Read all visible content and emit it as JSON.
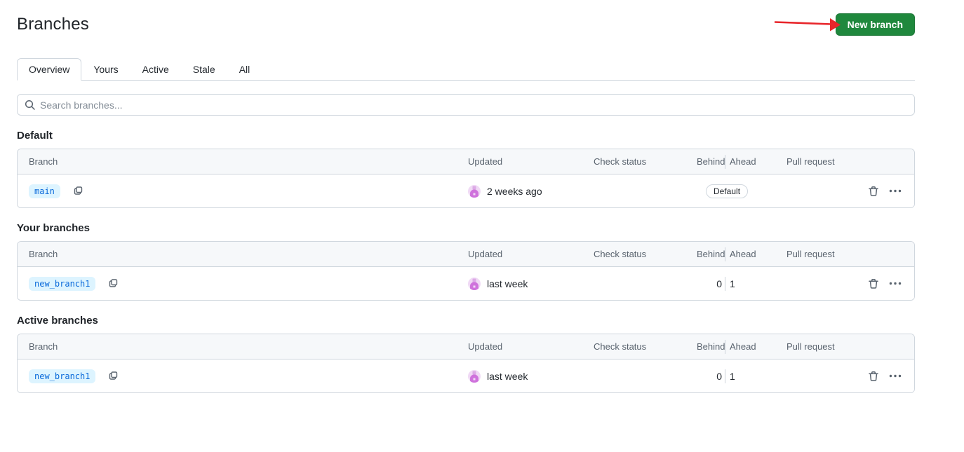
{
  "page": {
    "title": "Branches"
  },
  "header": {
    "new_branch_button": "New branch"
  },
  "tabs": [
    {
      "label": "Overview",
      "selected": true
    },
    {
      "label": "Yours",
      "selected": false
    },
    {
      "label": "Active",
      "selected": false
    },
    {
      "label": "Stale",
      "selected": false
    },
    {
      "label": "All",
      "selected": false
    }
  ],
  "search": {
    "placeholder": "Search branches..."
  },
  "table_headers": {
    "branch": "Branch",
    "updated": "Updated",
    "check_status": "Check status",
    "behind": "Behind",
    "ahead": "Ahead",
    "pull_request": "Pull request"
  },
  "sections": [
    {
      "heading": "Default",
      "rows": [
        {
          "branch": "main",
          "updated": "2 weeks ago",
          "badge": "Default"
        }
      ]
    },
    {
      "heading": "Your branches",
      "rows": [
        {
          "branch": "new_branch1",
          "updated": "last week",
          "behind": "0",
          "ahead": "1"
        }
      ]
    },
    {
      "heading": "Active branches",
      "rows": [
        {
          "branch": "new_branch1",
          "updated": "last week",
          "behind": "0",
          "ahead": "1"
        }
      ]
    }
  ],
  "colors": {
    "accent_green": "#1f883d",
    "annotation_red": "#e8252a",
    "branch_badge_bg": "#ddf4ff",
    "branch_badge_text": "#0969da",
    "border": "#d0d7de",
    "table_header_bg": "#f6f8fa"
  }
}
